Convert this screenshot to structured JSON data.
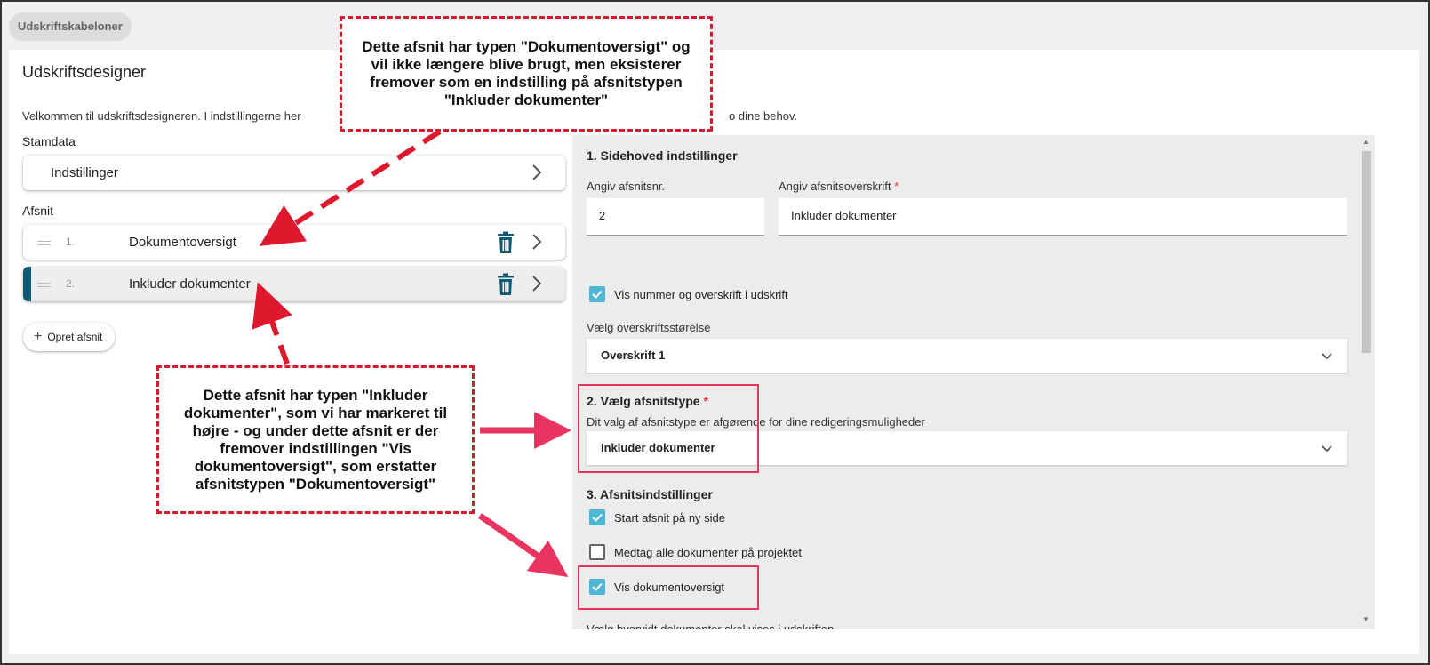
{
  "breadcrumb": {
    "label": "Udskriftskabeloner"
  },
  "page": {
    "title": "Udskriftsdesigner",
    "intro_start": "Velkommen til udskriftsdesigneren. I indstillingerne her",
    "intro_end": "o dine behov."
  },
  "left": {
    "stamdata_label": "Stamdata",
    "settings_item": "Indstillinger",
    "sections_label": "Afsnit",
    "sections": [
      {
        "num": "1.",
        "label": "Dokumentoversigt"
      },
      {
        "num": "2.",
        "label": "Inkluder dokumenter"
      }
    ],
    "add_button": "Opret afsnit"
  },
  "panel": {
    "header_settings_title": "1. Sidehoved indstillinger",
    "section_no_label": "Angiv afsnitsnr.",
    "section_no_value": "2",
    "section_heading_label": "Angiv afsnitsoverskrift",
    "section_heading_value": "Inkluder dokumenter",
    "required_mark": "*",
    "show_number_checkbox": "Vis nummer og overskrift i udskrift",
    "heading_size_label": "Vælg overskriftsstørelse",
    "heading_size_value": "Overskrift 1",
    "type_title": "2. Vælg afsnitstype",
    "type_help": "Dit valg af afsnitstype er afgørende for dine redigeringsmuligheder",
    "type_value": "Inkluder dokumenter",
    "section_settings_title": "3. Afsnitsindstillinger",
    "checkboxes": [
      {
        "label": "Start afsnit på ny side",
        "checked": true
      },
      {
        "label": "Medtag alle dokumenter på projektet",
        "checked": false
      },
      {
        "label": "Vis dokumentoversigt",
        "checked": true
      }
    ],
    "cut_off_text": "Vælg hvorvidt dokumenter skal vises i udskriften"
  },
  "callouts": {
    "top": "Dette afsnit har typen \"Dokumentoversigt\" og vil ikke længere blive brugt, men eksisterer fremover som en indstilling på afsnitstypen \"Inkluder dokumenter\"",
    "bottom": "Dette afsnit har typen \"Inkluder dokumenter\", som vi har markeret til højre - og under dette afsnit er der fremover indstillingen \"Vis dokumentoversigt\", som erstatter afsnitstypen \"Dokumentoversigt\""
  },
  "colors": {
    "accent": "#0f5a73",
    "checkbox": "#4db6d4",
    "highlight": "#e8345e",
    "callout_border": "#d81b2c"
  }
}
